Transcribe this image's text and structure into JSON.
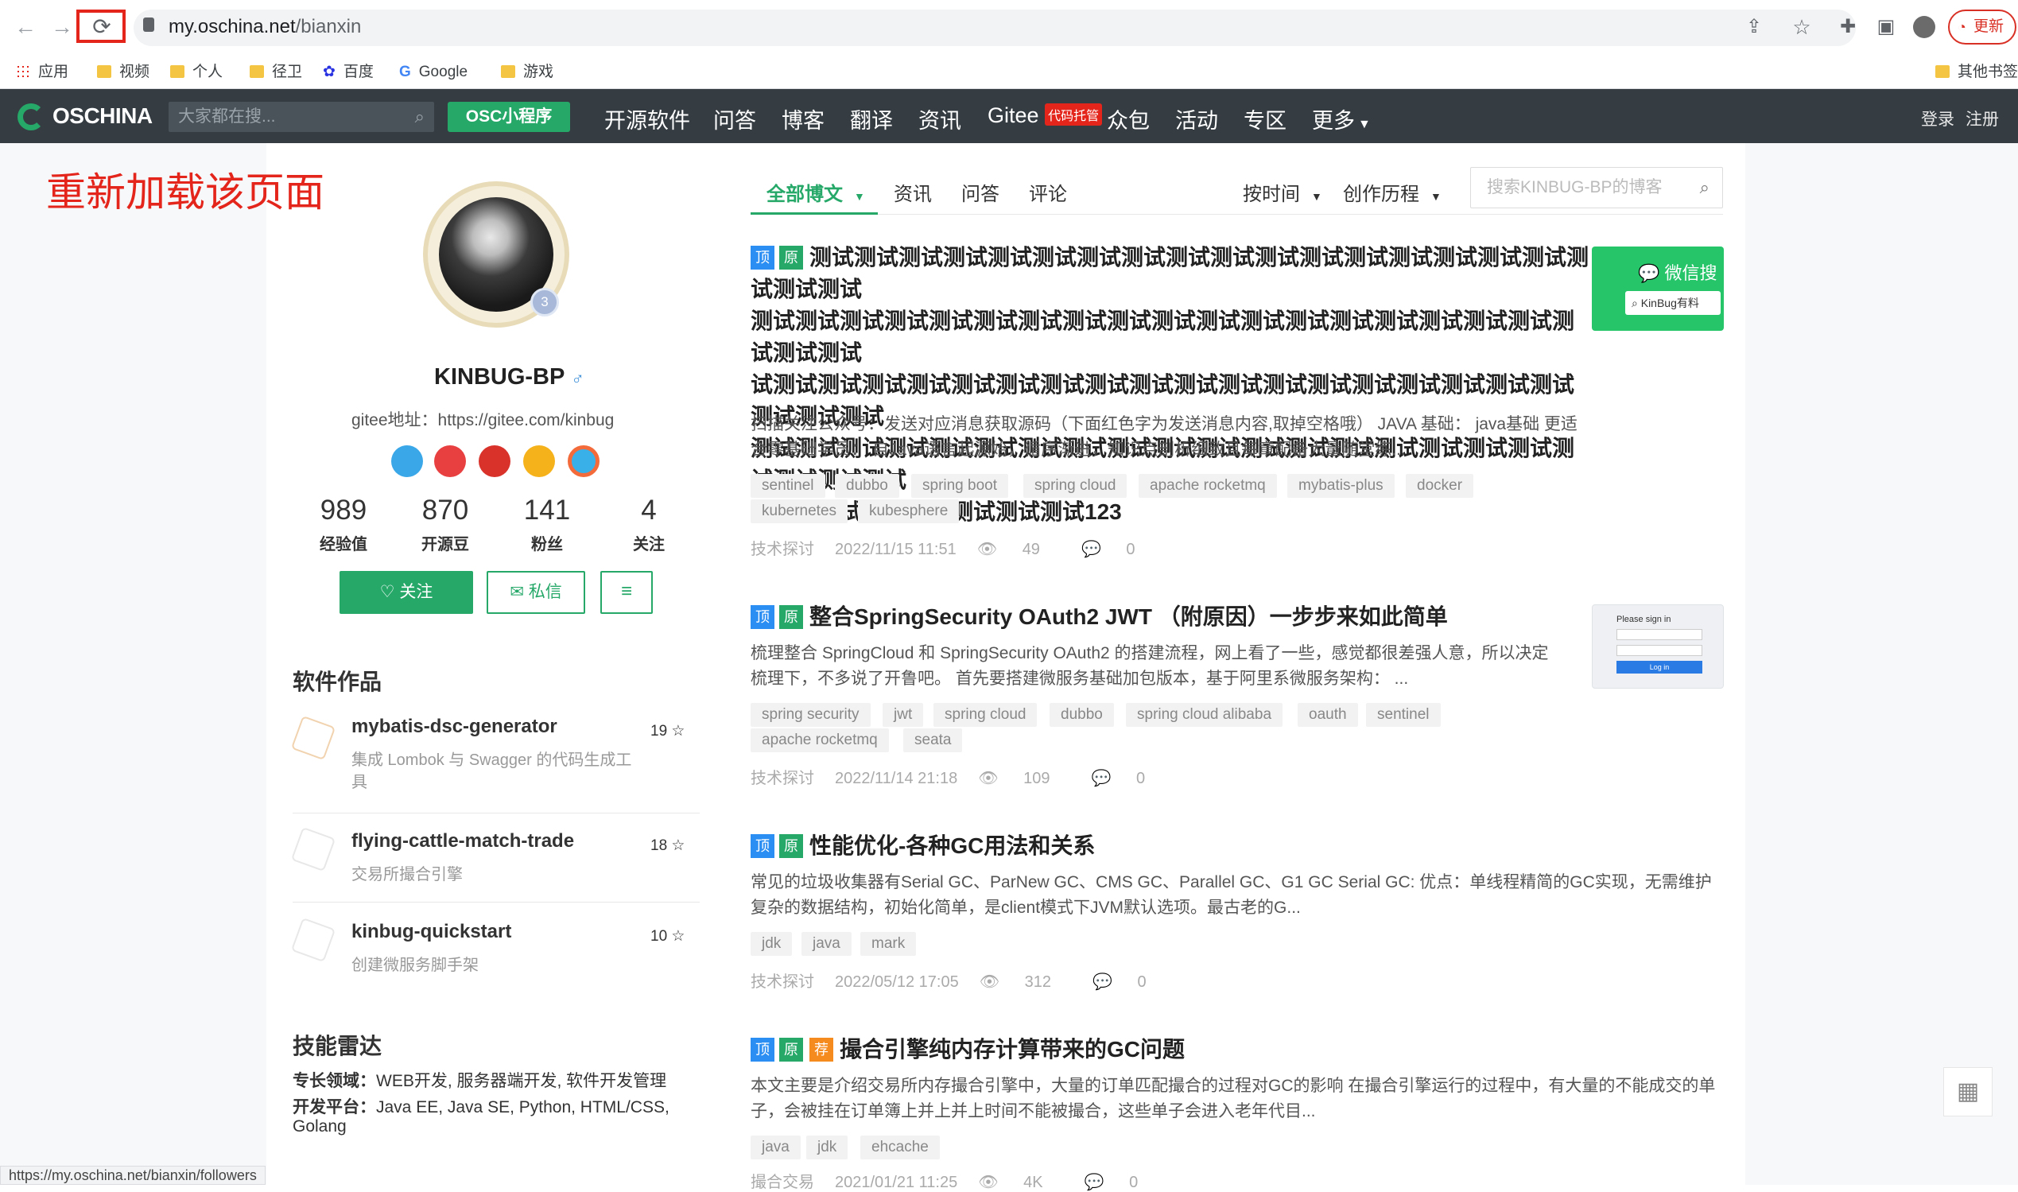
{
  "browser": {
    "url_host": "my.oschina.net",
    "url_path": "/bianxin",
    "update_label": "更新",
    "bookmarks": [
      "应用",
      "视频",
      "个人",
      "径卫",
      "百度",
      "Google",
      "游戏"
    ],
    "other_bookmarks": "其他书签",
    "status_url": "https://my.oschina.net/bianxin/followers"
  },
  "annotation": "重新加载该页面",
  "site": {
    "logo": "OSCHINA",
    "search_placeholder": "大家都在搜...",
    "mini_program": "OSC小程序",
    "nav": [
      "开源软件",
      "问答",
      "博客",
      "翻译",
      "资讯",
      "Gitee",
      "众包",
      "活动",
      "专区",
      "更多"
    ],
    "nav_badge": "代码托管",
    "login": "登录",
    "register": "注册"
  },
  "profile": {
    "level": "3",
    "username": "KINBUG-BP",
    "gender": "♂",
    "gitee": "gitee地址：https://gitee.com/kinbug",
    "stats": [
      {
        "value": "989",
        "label": "经验值"
      },
      {
        "value": "870",
        "label": "开源豆"
      },
      {
        "value": "141",
        "label": "粉丝"
      },
      {
        "value": "4",
        "label": "关注"
      }
    ],
    "follow": "关注",
    "message": "私信"
  },
  "software": {
    "title": "软件作品",
    "items": [
      {
        "name": "mybatis-dsc-generator",
        "desc": "集成 Lombok 与 Swagger 的代码生成工具",
        "stars": "19"
      },
      {
        "name": "flying-cattle-match-trade",
        "desc": "交易所撮合引擎",
        "stars": "18"
      },
      {
        "name": "kinbug-quickstart",
        "desc": "创建微服务脚手架",
        "stars": "10"
      }
    ]
  },
  "radar": {
    "title": "技能雷达",
    "field_label": "专长领域：",
    "field_value": "WEB开发, 服务器端开发, 软件开发管理",
    "platform_label": "开发平台：",
    "platform_value": "Java EE, Java SE, Python, HTML/CSS, Golang"
  },
  "tabs": {
    "all": "全部博文",
    "news": "资讯",
    "qa": "问答",
    "comments": "评论",
    "by_time": "按时间",
    "history": "创作历程",
    "search_placeholder": "搜索KINBUG-BP的博客"
  },
  "articles": [
    {
      "title_lines": [
        "测试测试测试测试测试测试测试测试测试测试测试测试测试测试测试测试测试测试测试测试",
        "测试测试测试测试测试测试测试测试测试测试测试测试测试测试测试测试测试测试测试测试测试",
        "试测试测试测试测试测试测试测试测试测试测试测试测试测试测试测试测试测试测试测试测试测试",
        "测试测试测试测试测试测试测试测试测试测试测试测试测试测试测试测试测试测试测试测试测试测试",
        "试测试测试测试测试测试测试测试123"
      ],
      "summary_lines": [
        "扫描关注公众号：发送对应消息获取源码（下面红色字为发送消息内容,取掉空格哦） JAVA 基础： java基础 更适",
        "合零基础学员： 自Java语言起源始，循序渐进，知识点剖析细致且每章配备大量随堂练..."
      ],
      "tags": [
        "sentinel",
        "dubbo",
        "spring boot",
        "spring cloud",
        "apache rocketmq",
        "mybatis-plus",
        "docker",
        "kubernetes",
        "kubesphere"
      ],
      "category": "技术探讨",
      "date": "2022/11/15 11:51",
      "views": "49",
      "comments": "0",
      "thumb_title": "微信搜",
      "thumb_search": "KinBug有料"
    },
    {
      "title_lines": [
        "整合SpringSecurity OAuth2 JWT （附原因）一步步来如此简单"
      ],
      "summary_lines": [
        "梳理整合 SpringCloud 和 SpringSecurity OAuth2 的搭建流程，网上看了一些，感觉都很差强人意，所以决定",
        "梳理下，不多说了开鲁吧。 首先要搭建微服务基础加包版本，基于阿里系微服务架构： ..."
      ],
      "tags": [
        "spring security",
        "jwt",
        "spring cloud",
        "dubbo",
        "spring cloud alibaba",
        "oauth",
        "sentinel",
        "apache rocketmq",
        "seata"
      ],
      "category": "技术探讨",
      "date": "2022/11/14 21:18",
      "views": "109",
      "comments": "0",
      "thumb_title": "Please sign in",
      "thumb_button": "Log in"
    },
    {
      "title_lines": [
        "性能优化-各种GC用法和关系"
      ],
      "summary_lines": [
        "常见的垃圾收集器有Serial GC、ParNew GC、CMS GC、Parallel GC、G1 GC Serial GC: 优点：单线程精简的GC实现，无需维护",
        "复杂的数据结构，初始化简单，是client模式下JVM默认选项。最古老的G..."
      ],
      "tags": [
        "jdk",
        "java",
        "mark"
      ],
      "category": "技术探讨",
      "date": "2022/05/12 17:05",
      "views": "312",
      "comments": "0"
    },
    {
      "title_lines": [
        "撮合引擎纯内存计算带来的GC问题"
      ],
      "summary_lines": [
        "本文主要是介绍交易所内存撮合引擎中，大量的订单匹配撮合的过程对GC的影响 在撮合引擎运行的过程中，有大量的不能成交的单",
        "子，会被挂在订单簿上并上并上时间不能被撮合，这些单子会进入老年代目..."
      ],
      "tags": [
        "java",
        "jdk",
        "ehcache"
      ],
      "category": "撮合交易",
      "date": "2021/01/21 11:25",
      "views": "4K",
      "comments": "0"
    }
  ],
  "labels": {
    "badge_top": "顶",
    "badge_orig": "原",
    "badge_rec": "荐"
  }
}
